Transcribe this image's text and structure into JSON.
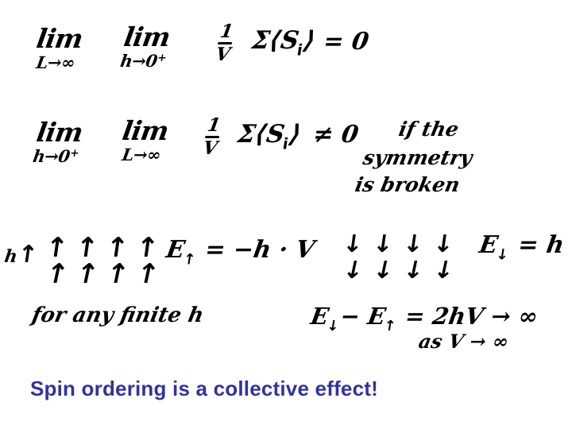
{
  "slide": {
    "background_color": "#ffffff",
    "ink_color": "#000000",
    "caption_color": "#333399"
  },
  "equations": {
    "line1": {
      "limit1_main": "lim",
      "limit1_sub": "L→∞",
      "limit2_main": "lim",
      "limit2_sub": "h→0",
      "limit2_sub_sup": "+",
      "frac_num": "1",
      "frac_den": "V",
      "body": "Σ⟨S",
      "body_sub": "i",
      "body_end": "⟩",
      "relation": "= 0"
    },
    "line2": {
      "limit1_main": "lim",
      "limit1_sub": "h→0",
      "limit1_sub_sup": "+",
      "limit2_main": "lim",
      "limit2_sub": "L→∞",
      "frac_num": "1",
      "frac_den": "V",
      "body": "Σ⟨S",
      "body_sub": "i",
      "body_end": "⟩",
      "relation": "≠ 0",
      "condition_line1": "if the",
      "condition_line2": "symmetry",
      "condition_line3": "is broken"
    },
    "energy_up": {
      "symbol": "E",
      "subscript": "↑",
      "value": "= −h · V"
    },
    "energy_down": {
      "symbol": "E",
      "subscript": "↓",
      "value": "= h V"
    },
    "energy_difference": {
      "expression": "E",
      "sub_down": "↓",
      "minus": "− E",
      "sub_up": "↑",
      "result": "= 2hV → ∞",
      "limit_note": "as V → ∞"
    },
    "finite_field_note": "for any finite h"
  },
  "field_label": {
    "symbol": "h",
    "arrow": "↑"
  },
  "spin_grid_up": {
    "rows": [
      [
        "↑",
        "↑",
        "↑",
        "↑"
      ],
      [
        "↑",
        "↑",
        "↑",
        "↑"
      ]
    ]
  },
  "spin_grid_down": {
    "rows": [
      [
        "↓",
        "↓",
        "↓",
        "↓"
      ],
      [
        "↓",
        "↓",
        "↓",
        "↓"
      ]
    ]
  },
  "caption": {
    "text": "Spin ordering is a collective effect!"
  }
}
